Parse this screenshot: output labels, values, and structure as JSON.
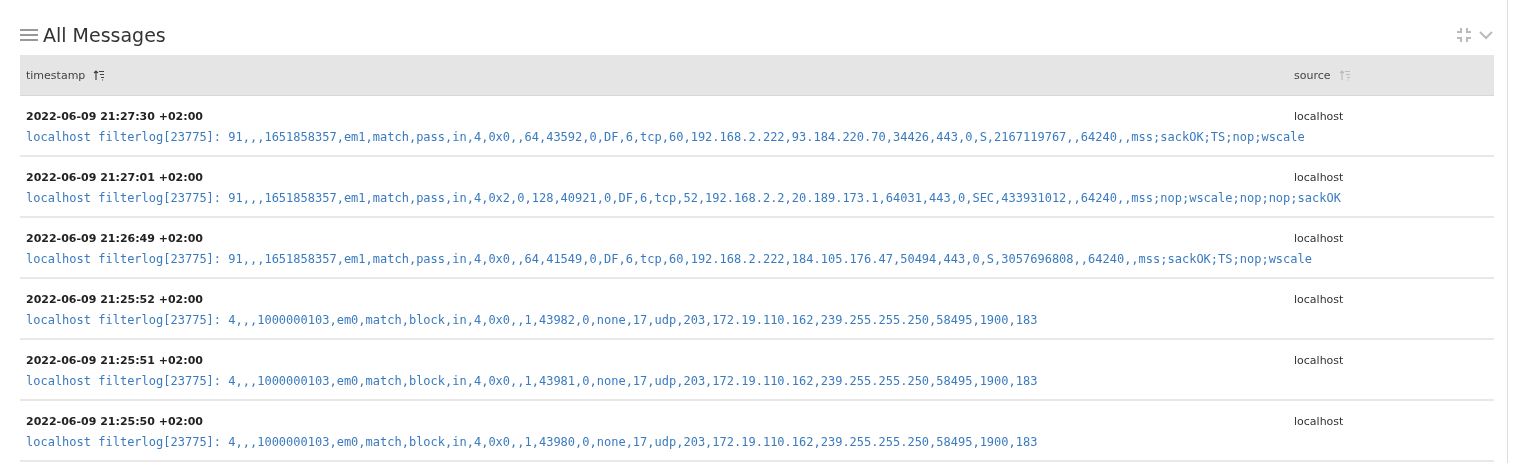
{
  "panel": {
    "title": "All Messages"
  },
  "table": {
    "columns": [
      {
        "label": "timestamp",
        "sort_active": true
      },
      {
        "label": "source",
        "sort_active": false
      }
    ],
    "rows": [
      {
        "timestamp": "2022-06-09 21:27:30 +02:00",
        "message": "localhost filterlog[23775]: 91,,,1651858357,em1,match,pass,in,4,0x0,,64,43592,0,DF,6,tcp,60,192.168.2.222,93.184.220.70,34426,443,0,S,2167119767,,64240,,mss;sackOK;TS;nop;wscale",
        "source": "localhost"
      },
      {
        "timestamp": "2022-06-09 21:27:01 +02:00",
        "message": "localhost filterlog[23775]: 91,,,1651858357,em1,match,pass,in,4,0x2,0,128,40921,0,DF,6,tcp,52,192.168.2.2,20.189.173.1,64031,443,0,SEC,433931012,,64240,,mss;nop;wscale;nop;nop;sackOK",
        "source": "localhost"
      },
      {
        "timestamp": "2022-06-09 21:26:49 +02:00",
        "message": "localhost filterlog[23775]: 91,,,1651858357,em1,match,pass,in,4,0x0,,64,41549,0,DF,6,tcp,60,192.168.2.222,184.105.176.47,50494,443,0,S,3057696808,,64240,,mss;sackOK;TS;nop;wscale",
        "source": "localhost"
      },
      {
        "timestamp": "2022-06-09 21:25:52 +02:00",
        "message": "localhost filterlog[23775]: 4,,,1000000103,em0,match,block,in,4,0x0,,1,43982,0,none,17,udp,203,172.19.110.162,239.255.255.250,58495,1900,183",
        "source": "localhost"
      },
      {
        "timestamp": "2022-06-09 21:25:51 +02:00",
        "message": "localhost filterlog[23775]: 4,,,1000000103,em0,match,block,in,4,0x0,,1,43981,0,none,17,udp,203,172.19.110.162,239.255.255.250,58495,1900,183",
        "source": "localhost"
      },
      {
        "timestamp": "2022-06-09 21:25:50 +02:00",
        "message": "localhost filterlog[23775]: 4,,,1000000103,em0,match,block,in,4,0x0,,1,43980,0,none,17,udp,203,172.19.110.162,239.255.255.250,58495,1900,183",
        "source": "localhost"
      }
    ]
  }
}
